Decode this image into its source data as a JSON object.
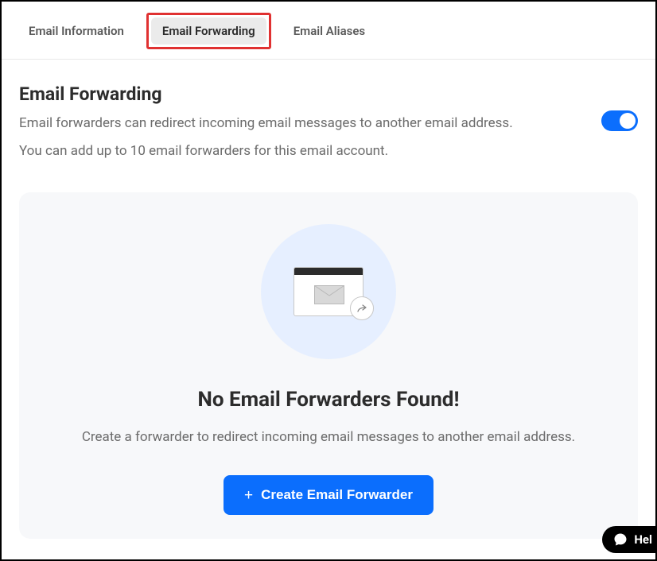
{
  "tabs": {
    "info": "Email Information",
    "forwarding": "Email Forwarding",
    "aliases": "Email Aliases"
  },
  "page": {
    "title": "Email Forwarding",
    "desc1": "Email forwarders can redirect incoming email messages to another email address.",
    "desc2": "You can add up to 10 email forwarders for this email account."
  },
  "empty": {
    "title": "No Email Forwarders Found!",
    "desc": "Create a forwarder to redirect incoming email messages to another email address.",
    "button": "Create Email Forwarder"
  },
  "help": {
    "label": "Hel"
  }
}
